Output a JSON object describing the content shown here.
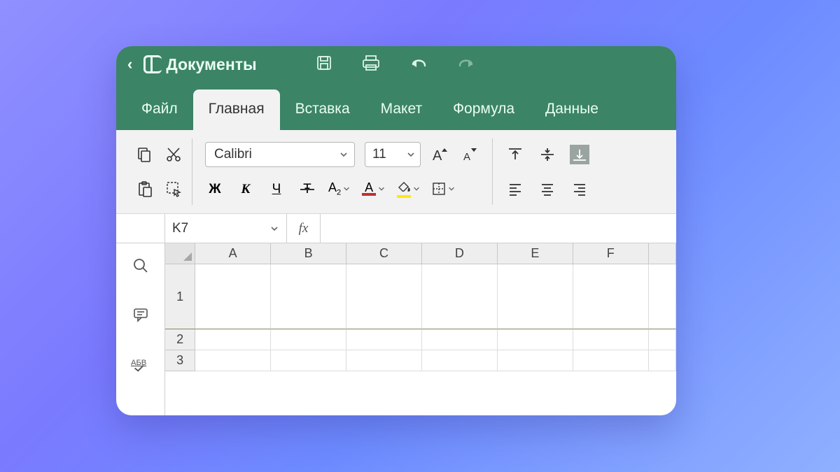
{
  "app": {
    "title": "Документы"
  },
  "menu": {
    "items": [
      {
        "label": "Файл"
      },
      {
        "label": "Главная",
        "active": true
      },
      {
        "label": "Вставка"
      },
      {
        "label": "Макет"
      },
      {
        "label": "Формула"
      },
      {
        "label": "Данные"
      }
    ]
  },
  "ribbon": {
    "font_name": "Calibri",
    "font_size": "11"
  },
  "formula_bar": {
    "cell_ref": "K7",
    "fx_label": "fx"
  },
  "grid": {
    "columns": [
      "A",
      "B",
      "C",
      "D",
      "E",
      "F"
    ],
    "rows": [
      "1",
      "2",
      "3"
    ]
  },
  "colors": {
    "brand_green": "#3c8466",
    "ribbon_bg": "#f2f2f2",
    "font_color_underline": "#c23030",
    "highlight_underline": "#ffea00"
  }
}
